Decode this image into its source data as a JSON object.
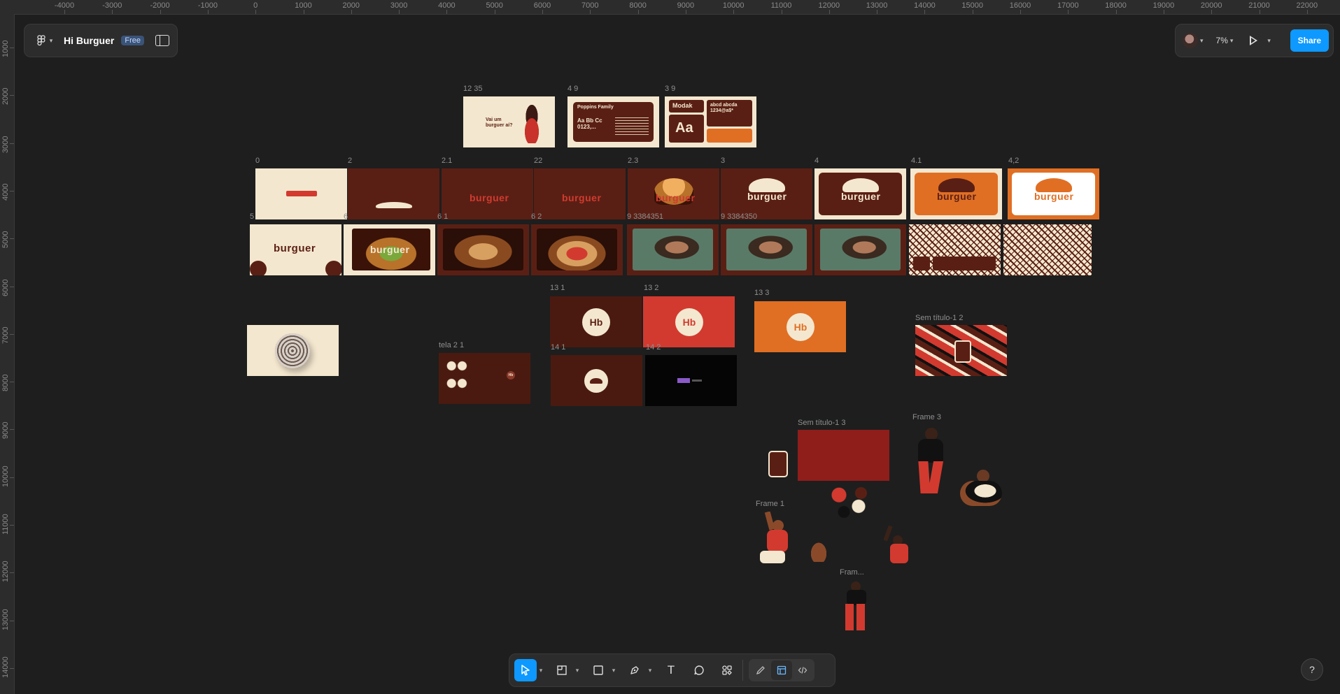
{
  "file": {
    "title": "Hi Burguer",
    "plan": "Free"
  },
  "toolbar_right": {
    "zoom": "7%",
    "share_label": "Share"
  },
  "ruler_top": [
    "-4000",
    "-3000",
    "-2000",
    "-1000",
    "0",
    "1000",
    "2000",
    "3000",
    "4000",
    "5000",
    "6000",
    "7000",
    "8000",
    "9000",
    "10000",
    "11000",
    "12000",
    "13000",
    "14000",
    "15000",
    "16000",
    "17000",
    "18000",
    "19000",
    "20000",
    "21000",
    "22000"
  ],
  "ruler_left": [
    "1000",
    "2000",
    "3000",
    "4000",
    "5000",
    "6000",
    "7000",
    "8000",
    "9000",
    "10000",
    "11000",
    "12000",
    "13000",
    "14000"
  ],
  "frames": {
    "f_12_35": "12 35",
    "f_4_9": "4 9",
    "f_3_9": "3 9",
    "f_0": "0",
    "f_2": "2",
    "f_2_1": "2.1",
    "f_22": "22",
    "f_2_3": "2.3",
    "f_3": "3",
    "f_4": "4",
    "f_4_1": "4.1",
    "f_4_2": "4,2",
    "f_5": "5",
    "f_6": "6",
    "f_6_1": "6 1",
    "f_6_2": "6 2",
    "f_9a": "9 3384351",
    "f_9b": "9 3384350",
    "f_13_1": "13 1",
    "f_13_2": "13 2",
    "f_13_3": "13 3",
    "f_sem_2": "Sem título-1 2",
    "f_tela": "tela 2 1",
    "f_14_1": "14 1",
    "f_14_2": "14 2",
    "f_sem_3": "Sem título-1 3",
    "f_frame3": "Frame 3",
    "f_frame1": "Frame 1",
    "f_fram": "Fram..."
  },
  "artwork_text": {
    "slide_headline": "Vai um burguer aí?",
    "poppins_title": "Poppins Family",
    "poppins_sample": "Aa Bb Cc 0123,...",
    "modak_title": "Modak",
    "modak_big": "Aa",
    "modak_sample": "abcd abcda 1234@a$*",
    "wordmark": "burguer",
    "hero_word": "burguer",
    "badge": "Hb"
  },
  "bottom_tools": {
    "move": "move-tool",
    "frame": "frame-tool",
    "shape": "rectangle-tool",
    "pen": "pen-tool",
    "text": "T",
    "comment": "comment-tool",
    "actions": "actions-tool"
  },
  "help_label": "?"
}
